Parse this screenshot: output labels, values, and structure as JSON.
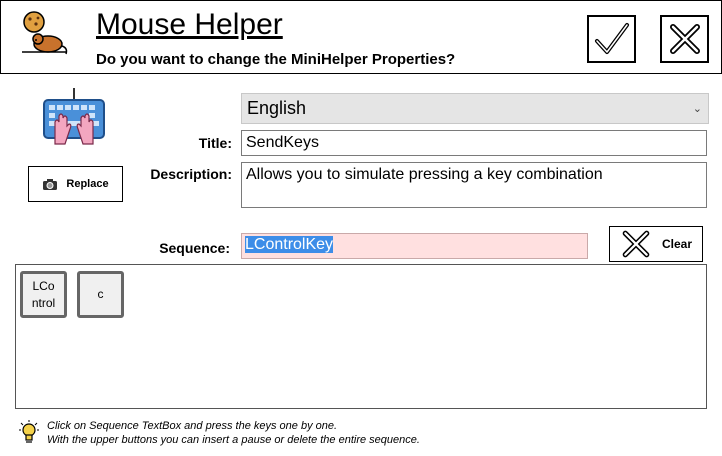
{
  "header": {
    "title": "Mouse Helper",
    "subtitle": "Do you want to change the MiniHelper Properties?",
    "logo_icon": "mouse-cookie-icon",
    "confirm_icon": "checkmark-icon",
    "close_icon": "close-x-icon"
  },
  "language": {
    "selected": "English"
  },
  "form": {
    "title_label": "Title:",
    "title_value": "SendKeys",
    "description_label": "Description:",
    "description_value": "Allows you to simulate pressing a key combination",
    "sequence_label": "Sequence:",
    "sequence_value": "LControlKey"
  },
  "buttons": {
    "replace_label": "Replace",
    "clear_label": "Clear"
  },
  "keys": [
    {
      "label": "LCo ntrol"
    },
    {
      "label": "c"
    }
  ],
  "hint": {
    "line1": "Click on Sequence TextBox and press the keys one by one.",
    "line2": "With the upper buttons you can insert a pause or delete the entire sequence."
  },
  "colors": {
    "sequence_bg": "#ffe0e0",
    "selection": "#3d8de8",
    "keyboard_icon": "#4a90d9",
    "hands_icon": "#f3a6c0"
  }
}
